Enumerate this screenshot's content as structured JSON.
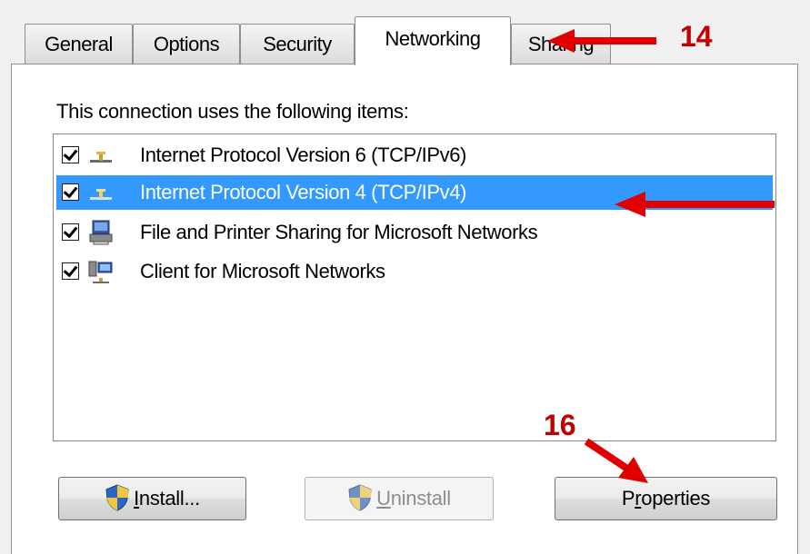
{
  "tabs": [
    {
      "label": "General",
      "active": false
    },
    {
      "label": "Options",
      "active": false
    },
    {
      "label": "Security",
      "active": false
    },
    {
      "label": "Networking",
      "active": true
    },
    {
      "label": "Sharing",
      "active": false
    }
  ],
  "panel": {
    "label": "This connection uses the following items:"
  },
  "items": [
    {
      "label": "Internet Protocol Version 6 (TCP/IPv6)",
      "checked": true,
      "icon": "network-protocol-icon",
      "selected": false
    },
    {
      "label": "Internet Protocol Version 4 (TCP/IPv4)",
      "checked": true,
      "icon": "network-protocol-icon",
      "selected": true
    },
    {
      "label": "File and Printer Sharing for Microsoft Networks",
      "checked": true,
      "icon": "printer-sharing-icon",
      "selected": false
    },
    {
      "label": "Client for Microsoft Networks",
      "checked": true,
      "icon": "network-client-icon",
      "selected": false
    }
  ],
  "buttons": {
    "install": {
      "label": "Install...",
      "mnemonic": "I",
      "rest": "nstall..."
    },
    "uninstall": {
      "label": "Uninstall",
      "mnemonic": "U",
      "rest": "ninstall",
      "disabled": true
    },
    "properties": {
      "label": "Properties",
      "pre": "P",
      "mnemonic": "r",
      "rest": "operties"
    }
  },
  "annotations": {
    "step14": "14",
    "step16": "16",
    "color": "#e00000"
  },
  "colors": {
    "selection": "#3399ff",
    "panel_border": "#8e8f8f"
  }
}
